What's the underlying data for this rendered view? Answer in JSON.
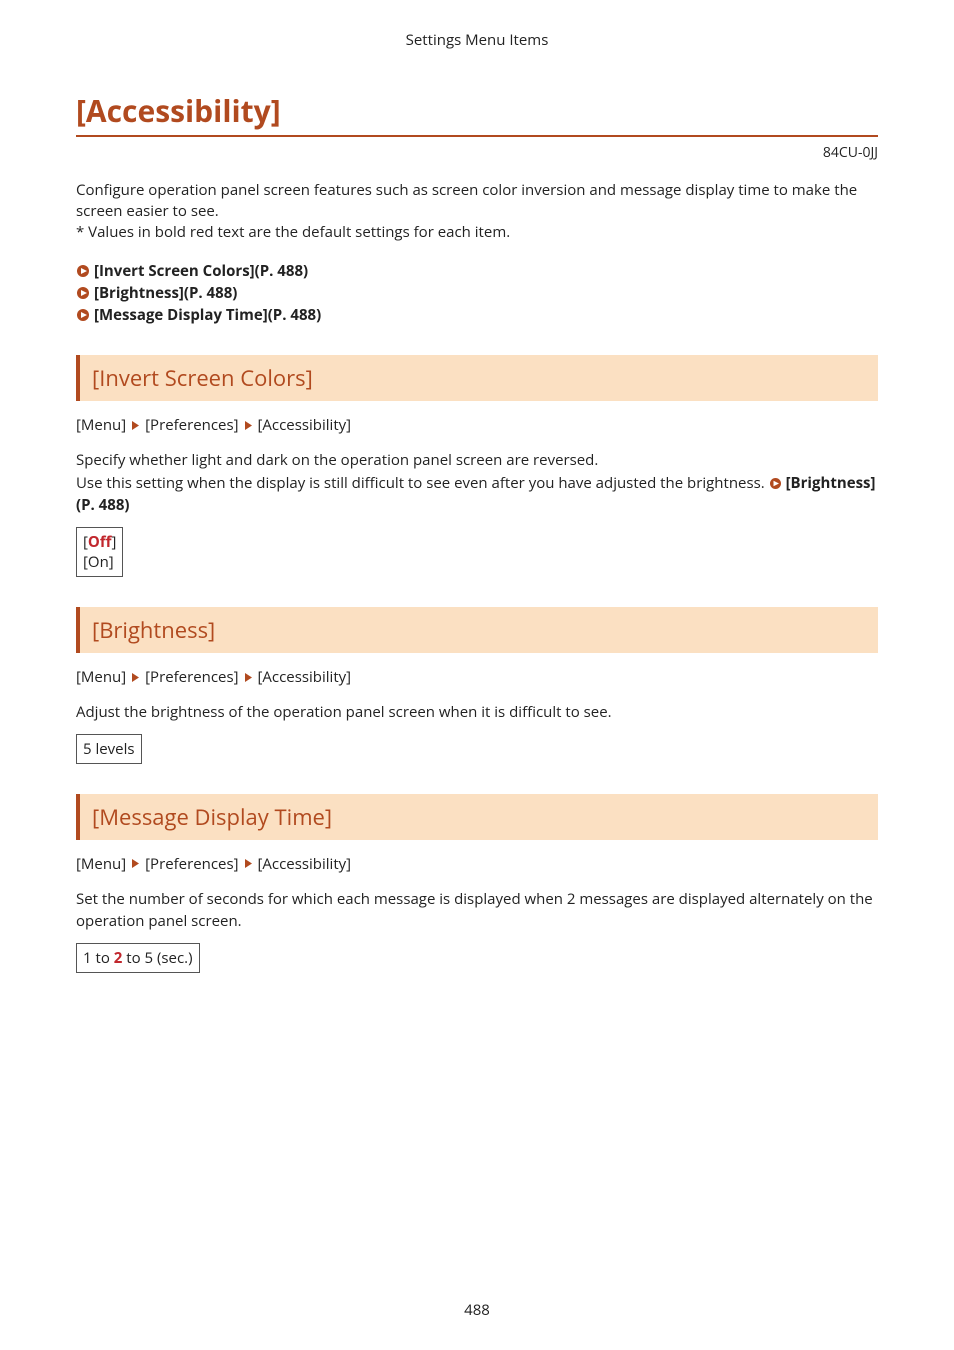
{
  "header": {
    "title": "Settings Menu Items"
  },
  "doc_code": "84CU-0JJ",
  "main_title": "[Accessibility]",
  "intro_line1": "Configure operation panel screen features such as screen color inversion and message display time to make the screen easier to see.",
  "intro_line2": "* Values in bold red text are the default settings for each item.",
  "toc": {
    "items": [
      "[Invert Screen Colors](P. 488)",
      "[Brightness](P. 488)",
      "[Message Display Time](P. 488)"
    ]
  },
  "breadcrumb": {
    "b1": "[Menu]",
    "b2": "[Preferences]",
    "b3": "[Accessibility]"
  },
  "sections": {
    "invert": {
      "heading": "[Invert Screen Colors]",
      "desc1": "Specify whether light and dark on the operation panel screen are reversed.",
      "desc2a": "Use this setting when the display is still difficult to see even after you have adjusted the brightness. ",
      "link_label": "[Brightness](P. 488)",
      "options": {
        "off_pre": "[",
        "off_val": "Off",
        "off_post": "]",
        "on": "[On]"
      }
    },
    "brightness": {
      "heading": "[Brightness]",
      "desc": "Adjust the brightness of the operation panel screen when it is difficult to see.",
      "options": "5 levels"
    },
    "message": {
      "heading": "[Message Display Time]",
      "desc": "Set the number of seconds for which each message is displayed when 2 messages are displayed alternately on the operation panel screen.",
      "options": {
        "pre": "1 to ",
        "def": "2",
        "post": " to 5 (sec.)"
      }
    }
  },
  "page_number": "488"
}
